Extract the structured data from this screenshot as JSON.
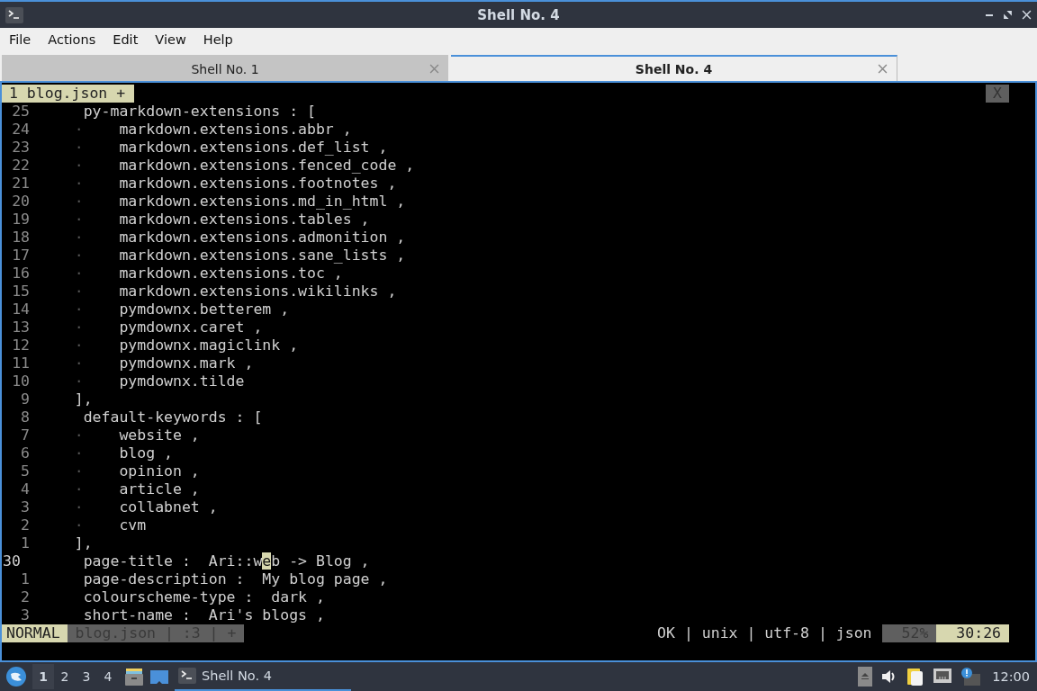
{
  "window": {
    "title": "Shell No. 4"
  },
  "menu": [
    "File",
    "Actions",
    "Edit",
    "View",
    "Help"
  ],
  "tabs": [
    {
      "label": "Shell No. 1",
      "selected": false
    },
    {
      "label": "Shell No. 4",
      "selected": true
    }
  ],
  "vim": {
    "buffer_tab": "1 blog.json +",
    "close_label": "X",
    "lines": [
      {
        "number": "25",
        "kind": "key",
        "current": false,
        "text": "py-markdown-extensions : ["
      },
      {
        "number": "24",
        "kind": "item",
        "current": false,
        "guide": "·",
        "text": "markdown.extensions.abbr ,"
      },
      {
        "number": "23",
        "kind": "item",
        "current": false,
        "guide": "·",
        "text": "markdown.extensions.def_list ,"
      },
      {
        "number": "22",
        "kind": "item",
        "current": false,
        "guide": "·",
        "text": "markdown.extensions.fenced_code ,"
      },
      {
        "number": "21",
        "kind": "item",
        "current": false,
        "guide": "·",
        "text": "markdown.extensions.footnotes ,"
      },
      {
        "number": "20",
        "kind": "item",
        "current": false,
        "guide": "·",
        "text": "markdown.extensions.md_in_html ,"
      },
      {
        "number": "19",
        "kind": "item",
        "current": false,
        "guide": "·",
        "text": "markdown.extensions.tables ,"
      },
      {
        "number": "18",
        "kind": "item",
        "current": false,
        "guide": "·",
        "text": "markdown.extensions.admonition ,"
      },
      {
        "number": "17",
        "kind": "item",
        "current": false,
        "guide": "·",
        "text": "markdown.extensions.sane_lists ,"
      },
      {
        "number": "16",
        "kind": "item",
        "current": false,
        "guide": "·",
        "text": "markdown.extensions.toc ,"
      },
      {
        "number": "15",
        "kind": "item",
        "current": false,
        "guide": "·",
        "text": "markdown.extensions.wikilinks ,"
      },
      {
        "number": "14",
        "kind": "item",
        "current": false,
        "guide": "·",
        "text": "pymdownx.betterem ,"
      },
      {
        "number": "13",
        "kind": "item",
        "current": false,
        "guide": "·",
        "text": "pymdownx.caret ,"
      },
      {
        "number": "12",
        "kind": "item",
        "current": false,
        "guide": "·",
        "text": "pymdownx.magiclink ,"
      },
      {
        "number": "11",
        "kind": "item",
        "current": false,
        "guide": "·",
        "text": "pymdownx.mark ,"
      },
      {
        "number": "10",
        "kind": "item",
        "current": false,
        "guide": "·",
        "text": "pymdownx.tilde"
      },
      {
        "number": "9",
        "kind": "close",
        "current": false,
        "text": "],"
      },
      {
        "number": "8",
        "kind": "key",
        "current": false,
        "text": "default-keywords : ["
      },
      {
        "number": "7",
        "kind": "item",
        "current": false,
        "guide": "·",
        "text": "website ,"
      },
      {
        "number": "6",
        "kind": "item",
        "current": false,
        "guide": "·",
        "text": "blog ,"
      },
      {
        "number": "5",
        "kind": "item",
        "current": false,
        "guide": "·",
        "text": "opinion ,"
      },
      {
        "number": "4",
        "kind": "item",
        "current": false,
        "guide": "·",
        "text": "article ,"
      },
      {
        "number": "3",
        "kind": "item",
        "current": false,
        "guide": "·",
        "text": "collabnet ,"
      },
      {
        "number": "2",
        "kind": "item",
        "current": false,
        "guide": "·",
        "text": "cvm"
      },
      {
        "number": "1",
        "kind": "close",
        "current": false,
        "text": "],"
      },
      {
        "number": "30",
        "kind": "key",
        "current": true,
        "text": "page-title :  Ari::w",
        "cursor": "e",
        "text_after": "b -> Blog ,"
      },
      {
        "number": "1",
        "kind": "key",
        "current": false,
        "text": "page-description :  My blog page ,"
      },
      {
        "number": "2",
        "kind": "key",
        "current": false,
        "text": "colourscheme-type :  dark ,"
      },
      {
        "number": "3",
        "kind": "key",
        "current": false,
        "text": "short-name :  Ari's blogs ,"
      }
    ],
    "status": {
      "mode": "NORMAL",
      "file_info": "blog.json | :3 | +",
      "file_details": "OK | unix | utf-8 | json",
      "percent": "52%",
      "position": "30:26"
    }
  },
  "taskbar": {
    "workspaces": [
      {
        "label": "1",
        "selected": true
      },
      {
        "label": "2",
        "selected": false
      },
      {
        "label": "3",
        "selected": false
      },
      {
        "label": "4",
        "selected": false
      }
    ],
    "task": {
      "label": "Shell No. 4"
    },
    "clock": "12:00"
  }
}
